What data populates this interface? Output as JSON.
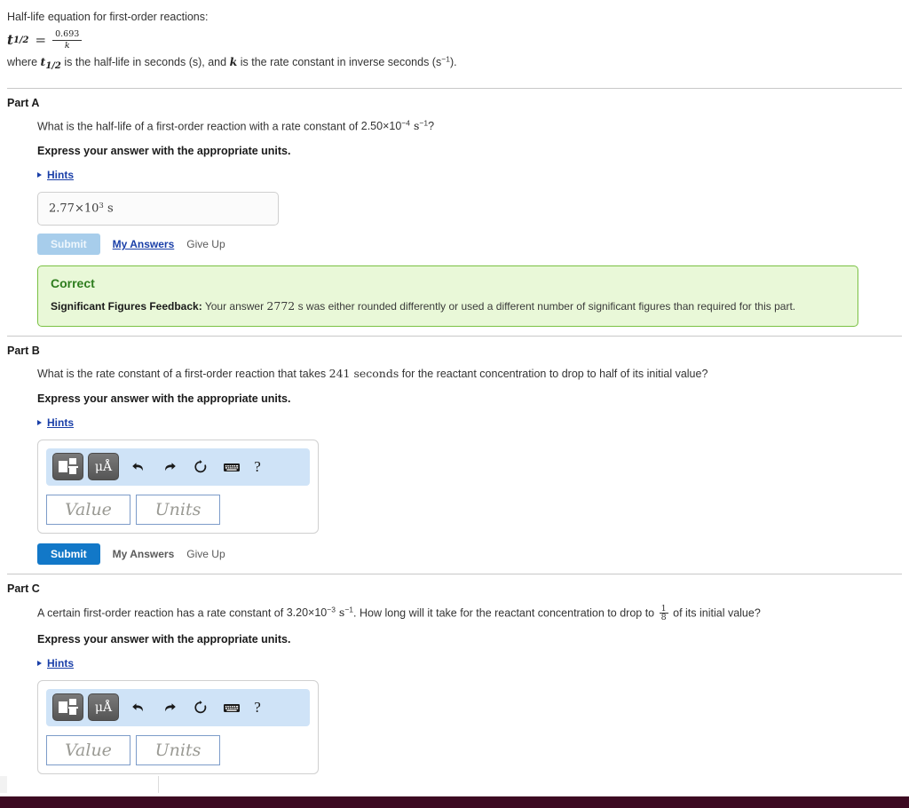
{
  "intro": {
    "heading": "Half-life equation for first-order reactions:",
    "equation": {
      "lhs_var": "t",
      "lhs_sub": "1/2",
      "equals": "=",
      "numerator": "0.693",
      "denominator": "k"
    },
    "where_prefix": "where ",
    "where_var": "t",
    "where_sub": "1/2",
    "where_mid": " is the half-life in seconds (s), and ",
    "where_var2": "k",
    "where_tail": " is the rate constant in inverse seconds (s",
    "where_exp": "−1",
    "where_end": ")."
  },
  "parts": [
    {
      "title": "Part A",
      "question_pre": "What is the half-life of a first-order reaction with a rate constant of ",
      "question_coeff": "2.50×10",
      "question_exp": "−4",
      "question_unit": " s",
      "question_unit_exp": "−1",
      "question_post": "?",
      "instruction": "Express your answer with the appropriate units.",
      "hints_label": "Hints",
      "answer_value": "2.77×10",
      "answer_exp": "3",
      "answer_units": " s",
      "submit_label": "Submit",
      "my_answers_label": "My Answers",
      "give_up_label": "Give Up",
      "submit_state": "disabled",
      "feedback": {
        "title": "Correct",
        "label": "Significant Figures Feedback:",
        "text_pre": " Your answer ",
        "value": "2772",
        "text_post": " s was either rounded differently or used a different number of significant figures than required for this part."
      }
    },
    {
      "title": "Part B",
      "question_pre": "What is the rate constant of a first-order reaction that takes ",
      "question_value": "241 seconds",
      "question_post": " for the reactant concentration to drop to half of its initial value?",
      "instruction": "Express your answer with the appropriate units.",
      "hints_label": "Hints",
      "submit_label": "Submit",
      "my_answers_label": "My Answers",
      "give_up_label": "Give Up",
      "submit_state": "active"
    },
    {
      "title": "Part C",
      "question_pre": "A certain first-order reaction has a rate constant of ",
      "question_coeff": "3.20×10",
      "question_exp": "−3",
      "question_unit": " s",
      "question_unit_exp": "−1",
      "question_mid": ". How long will it take for the reactant concentration to drop to ",
      "fraction_num": "1",
      "fraction_den": "8",
      "question_post": " of its initial value?",
      "instruction": "Express your answer with the appropriate units.",
      "hints_label": "Hints"
    }
  ],
  "math_widget": {
    "template_button": "template-icon",
    "units_button": "μÅ",
    "undo_icon": "undo-icon",
    "redo_icon": "redo-icon",
    "reset_icon": "reset-icon",
    "keyboard_icon": "keyboard-icon",
    "help_label": "?",
    "value_placeholder": "Value",
    "units_placeholder": "Units"
  },
  "colors": {
    "link": "#1a3fa8",
    "submit_active": "#1278c8",
    "submit_disabled": "#a7cdeb",
    "feedback_bg": "#e9f8d8",
    "feedback_border": "#7ac143",
    "feedback_title": "#2e7d1e",
    "toolbar_bg": "#cfe3f7",
    "footer": "#3d0a22"
  }
}
